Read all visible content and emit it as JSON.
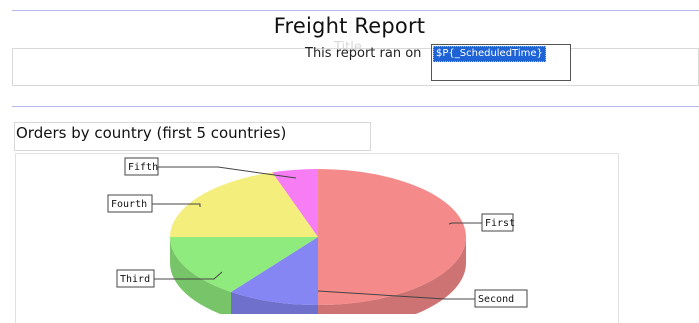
{
  "report": {
    "title": "Freight Report",
    "ran_on_text": "This report ran on",
    "scheduled_param": "$P{_ScheduledTime}",
    "ghost_text": "Title"
  },
  "chart": {
    "heading": "Orders by country (first 5 countries)"
  },
  "chart_data": {
    "type": "pie",
    "title": "Orders by country (first 5 countries)",
    "categories": [
      "First",
      "Second",
      "Third",
      "Fourth",
      "Fifth"
    ],
    "values": [
      50,
      10,
      15,
      20,
      5
    ],
    "colors": [
      "#f47a7a",
      "#7474f2",
      "#80e86b",
      "#f2ec6b",
      "#f56bf2"
    ],
    "style": "3d",
    "legend": "none"
  }
}
